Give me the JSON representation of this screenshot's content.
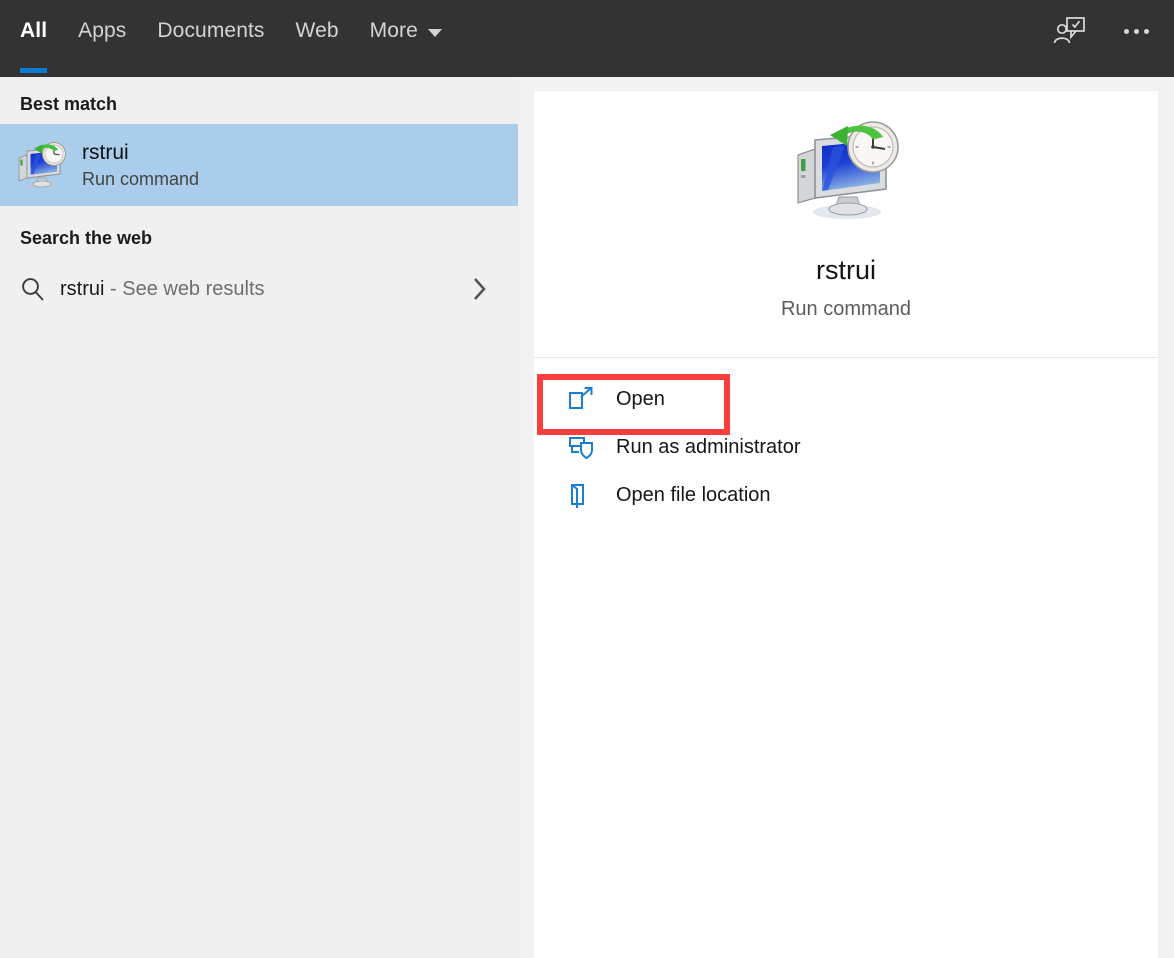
{
  "header": {
    "tabs": [
      {
        "label": "All",
        "active": true
      },
      {
        "label": "Apps",
        "active": false
      },
      {
        "label": "Documents",
        "active": false
      },
      {
        "label": "Web",
        "active": false
      },
      {
        "label": "More",
        "active": false
      }
    ],
    "more_caret_icon": "chevron-down-icon",
    "feedback_icon": "feedback-person-icon",
    "overflow_icon": "ellipsis-icon",
    "background_color": "#333333",
    "active_underline_color": "#0a7bd4"
  },
  "left_pane": {
    "best_match_header": "Best match",
    "best_match": {
      "title": "rstrui",
      "subtitle": "Run command",
      "icon": "system-restore-icon",
      "selected": true,
      "highlight_color": "#a9cdea"
    },
    "search_web_header": "Search the web",
    "web_result": {
      "query": "rstrui",
      "suffix": " - See web results",
      "search_icon": "search-icon",
      "chevron_icon": "chevron-right-icon"
    },
    "background_color": "#f0f0f0"
  },
  "right_pane": {
    "preview": {
      "title": "rstrui",
      "subtitle": "Run command",
      "icon": "system-restore-icon"
    },
    "actions": [
      {
        "label": "Open",
        "icon": "open-external-icon",
        "highlighted": true
      },
      {
        "label": "Run as administrator",
        "icon": "shield-window-icon",
        "highlighted": false
      },
      {
        "label": "Open file location",
        "icon": "folder-open-icon",
        "highlighted": false
      }
    ],
    "background_color": "#ffffff",
    "icon_accent_color": "#1a7fd4"
  },
  "annotation": {
    "target_label": "Open",
    "box_color": "#fa3e3e"
  }
}
